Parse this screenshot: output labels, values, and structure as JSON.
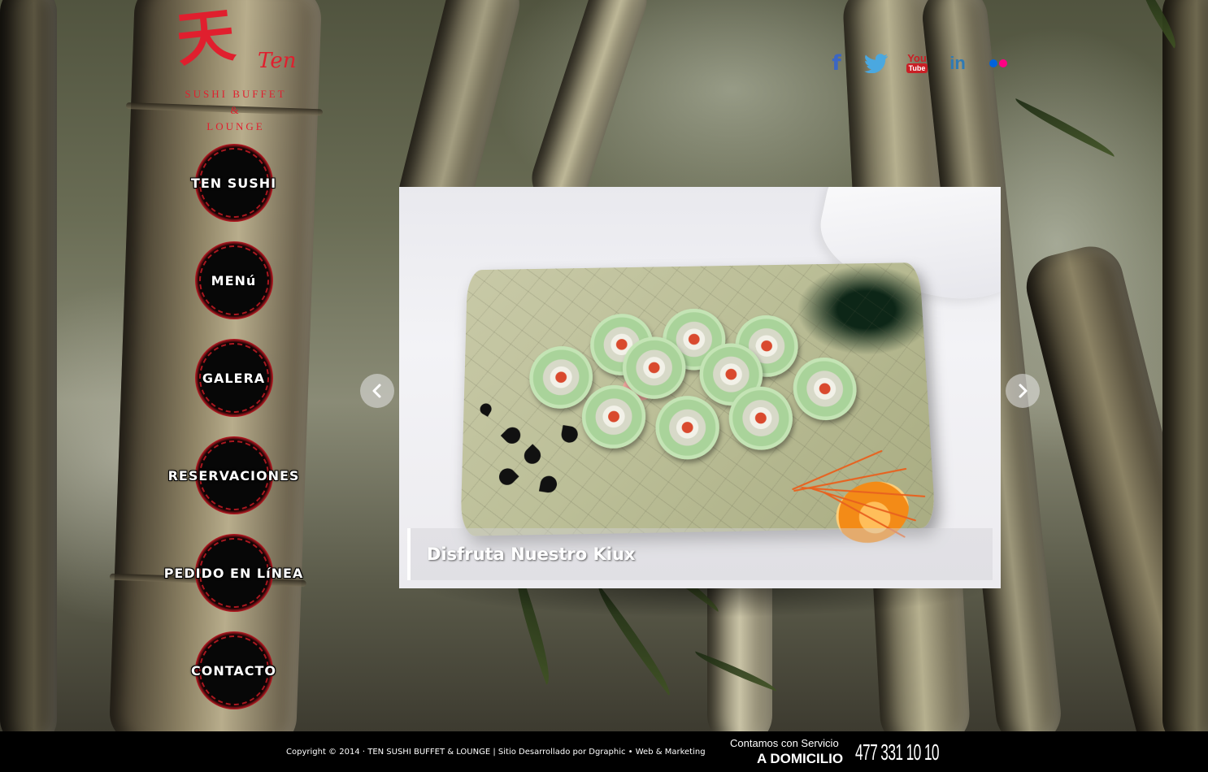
{
  "logo": {
    "kanji": "天",
    "script": "Ten",
    "line1": "SUSHI BUFFET",
    "line2": "&",
    "line3": "LOUNGE"
  },
  "nav": {
    "items": [
      {
        "label": "TEN SUSHI"
      },
      {
        "label": "MENú"
      },
      {
        "label": "GALERA"
      },
      {
        "label": "RESERVACIONES"
      },
      {
        "label": "PEDIDO EN LíNEA"
      },
      {
        "label": "CONTACTO"
      }
    ]
  },
  "social": {
    "facebook": "f",
    "youtube_top": "You",
    "youtube_bottom": "Tube",
    "linkedin": "in",
    "icons": [
      "facebook-icon",
      "twitter-icon",
      "youtube-icon",
      "linkedin-icon",
      "flickr-icon"
    ]
  },
  "slider": {
    "caption": "Disfruta Nuestro Kiux",
    "prev_icon": "chevron-left-icon",
    "next_icon": "chevron-right-icon"
  },
  "footer": {
    "copyright": "Copyright © 2014 · TEN SUSHI BUFFET & LOUNGE | Sitio Desarrollado por Dgraphic • Web & Marketing",
    "delivery_top": "Contamos con Servicio",
    "delivery_bottom": "A DOMICILIO",
    "phone": "477 331 10 10"
  },
  "colors": {
    "brand_red": "#e01f2e",
    "facebook": "#3b66c4",
    "twitter": "#4aa8e0",
    "youtube": "#c91f25",
    "linkedin": "#2f7ab5",
    "flickr_blue": "#0063dc",
    "flickr_pink": "#ff0084",
    "footer_bg": "#000000"
  }
}
